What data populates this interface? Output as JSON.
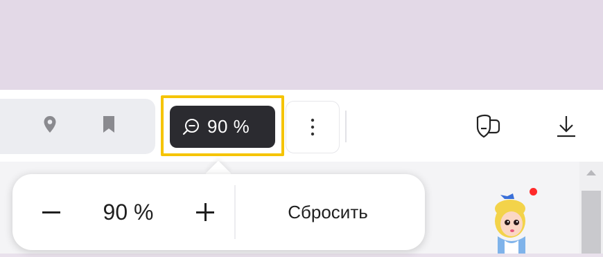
{
  "titlebar": {
    "icons": [
      "bookmarks-collections-icon",
      "menu-icon",
      "minimize-icon",
      "maximize-icon",
      "close-icon"
    ]
  },
  "omnibox": {
    "icons": [
      "location-pin-icon",
      "bookmark-icon"
    ]
  },
  "zoom_indicator": {
    "label": "90 %",
    "icon": "zoom-out-icon",
    "highlight_color": "#f5c400"
  },
  "toolbar": {
    "icons": [
      "more-vertical-icon",
      "protect-icon",
      "download-icon"
    ]
  },
  "zoom_popup": {
    "decrease_label": "−",
    "zoom_value": "90 %",
    "increase_label": "+",
    "reset_label": "Сбросить"
  },
  "colors": {
    "accent": "#f5c400",
    "pill_bg": "#2b2b30",
    "titlebar_bg": "#e3d9e7",
    "notification_dot": "#ff2a2a"
  }
}
